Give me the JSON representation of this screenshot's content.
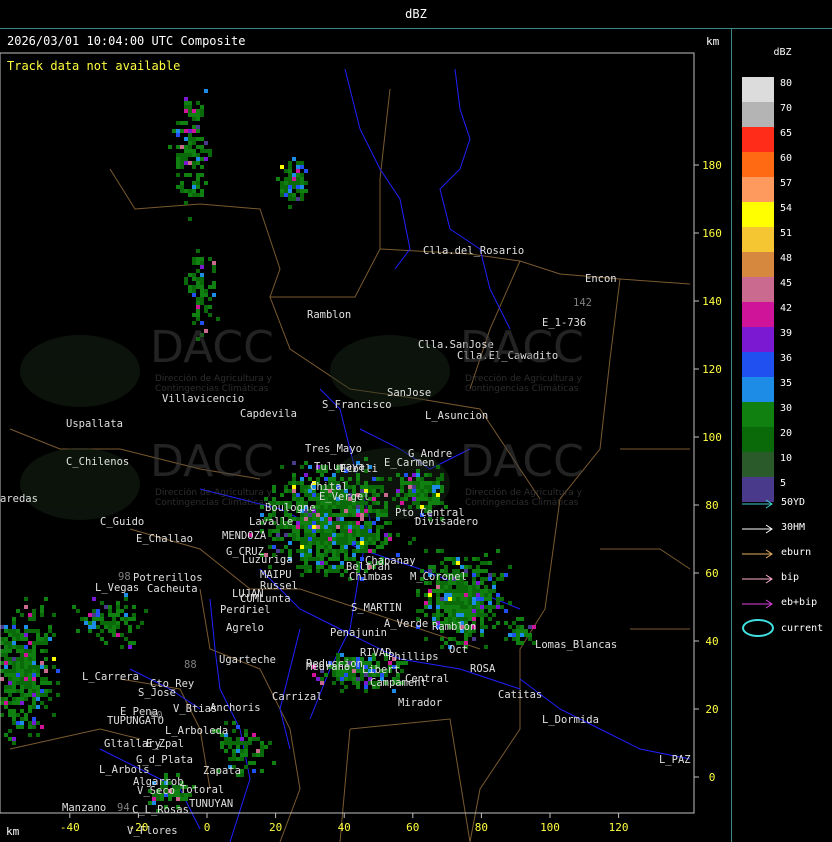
{
  "window": {
    "title": "dBZ"
  },
  "map": {
    "timestamp": "2026/03/01 10:04:00 UTC Composite",
    "track_message": "Track data not available",
    "unit_top": "km",
    "unit_bottom": "km",
    "x_ticks": [
      "-40",
      "-20",
      "0",
      "20",
      "40",
      "60",
      "80",
      "100",
      "120"
    ],
    "y_ticks": [
      "180",
      "160",
      "140",
      "120",
      "100",
      "80",
      "60",
      "40",
      "20",
      "0"
    ],
    "watermark": "DACC",
    "watermark_sub": "Dirección de Agricultura y Contingencias Climáticas",
    "places": [
      "Clla.del_Rosario",
      "Encon",
      "142",
      "E_1-736",
      "Ramblon",
      "Clla.SanJose",
      "Clla.El_Cawadito",
      "SanJose",
      "L_Asuncion",
      "Villavicencio",
      "Capdevila",
      "S_Francisco",
      "Uspallata",
      "Tres_Mayo",
      "G_Andre",
      "C_Chilenos",
      "Tulumaya",
      "E_Carmen",
      "Chital",
      "E_Vergel",
      "Ecotli",
      "aredas",
      "Boulogne",
      "Pto_Central",
      "Lavalle",
      "Divisadero",
      "C_Guido",
      "E_Challao",
      "MENDOZA",
      "G_CRUZ",
      "Luzuriga",
      "Chapanay",
      "Beltran",
      "Potrerillos",
      "Cacheuta",
      "MAIPU",
      "Russel",
      "Chimbas",
      "M_Coronel",
      "L_Vegas",
      "LUJAN",
      "CUMLunta",
      "Perdriel",
      "S_MARTIN",
      "Agrelo",
      "A_Verde",
      "Ramblon",
      "Ugarteche",
      "Penajunin",
      "RIVAD",
      "Phillips",
      "Oct",
      "Lomas_Blancas",
      "L_Carrera",
      "Cto_Rey",
      "Medrano",
      "Reduccion",
      "Libert",
      "Campament",
      "Central",
      "ROSA",
      "Catitas",
      "S_Jose",
      "Carrizal",
      "E_Pena",
      "TUPUNGATO",
      "V_Btias",
      "Anchoris",
      "Mirador",
      "L_Dormida",
      "L_Arboleda",
      "Gltallary",
      "E_Zpal",
      "L_Arbols",
      "G_d_Plata",
      "Zapata",
      "L_PAZ",
      "Algarrob",
      "V_Seco",
      "Totoral",
      "TUNUYAN",
      "Manzano",
      "C_L_Rosas",
      "V_Flores",
      "98",
      "88",
      "90",
      "94"
    ]
  },
  "legend": {
    "title": "dBZ",
    "levels": [
      {
        "label": "80",
        "color": "#dcdcdc"
      },
      {
        "label": "70",
        "color": "#b4b4b4"
      },
      {
        "label": "65",
        "color": "#ff2c1a"
      },
      {
        "label": "60",
        "color": "#ff6a12"
      },
      {
        "label": "57",
        "color": "#ff9a5e"
      },
      {
        "label": "54",
        "color": "#ffff00"
      },
      {
        "label": "51",
        "color": "#f5c631"
      },
      {
        "label": "48",
        "color": "#d6883e"
      },
      {
        "label": "45",
        "color": "#c96a8e"
      },
      {
        "label": "42",
        "color": "#d0149a"
      },
      {
        "label": "39",
        "color": "#7a18d2"
      },
      {
        "label": "36",
        "color": "#2050f0"
      },
      {
        "label": "35",
        "color": "#1c8ce6"
      },
      {
        "label": "30",
        "color": "#108010"
      },
      {
        "label": "20",
        "color": "#0a6a0a"
      },
      {
        "label": "10",
        "color": "#2a5a2a"
      },
      {
        "label": "5",
        "color": "#4a3a8c"
      }
    ],
    "tracks": [
      {
        "label": "50YD",
        "color": "#40d0d0"
      },
      {
        "label": "30HM",
        "color": "#ffffff"
      },
      {
        "label": "eburn",
        "color": "#e8b060"
      },
      {
        "label": "bip",
        "color": "#ffb0d0"
      },
      {
        "label": "eb+bip",
        "color": "#e040e0"
      }
    ],
    "current_label": "current",
    "current_color": "#40e0e0"
  }
}
